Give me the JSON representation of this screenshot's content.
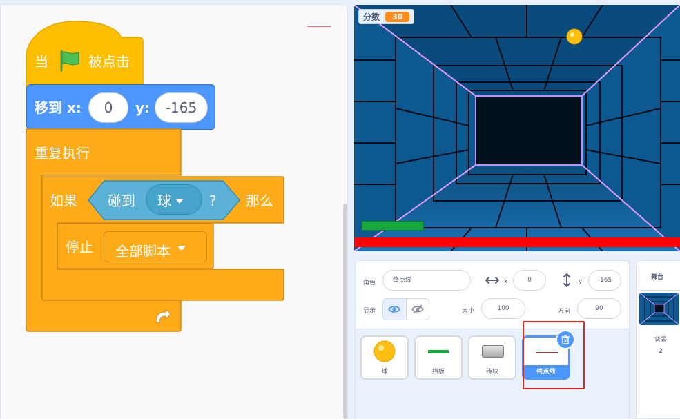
{
  "code": {
    "hat": {
      "prefix": "当",
      "suffix": "被点击"
    },
    "goto": {
      "label": "移到 x:",
      "x_value": "0",
      "y_label": "y:",
      "y_value": "-165"
    },
    "forever": {
      "label": "重复执行"
    },
    "if_block": {
      "if_label": "如果",
      "touching_label": "碰到",
      "touching_target": "球",
      "question": "?",
      "then_label": "那么"
    },
    "stop": {
      "label": "停止",
      "option": "全部脚本"
    }
  },
  "stage": {
    "monitor": {
      "label": "分数",
      "value": "30"
    }
  },
  "sprite_info": {
    "sprite_label": "角色",
    "sprite_name": "终点线",
    "x_label": "x",
    "x_value": "0",
    "y_label": "y",
    "y_value": "-165",
    "show_label": "显示",
    "size_label": "大小",
    "size_value": "100",
    "direction_label": "方向",
    "direction_value": "90"
  },
  "sprites": [
    {
      "name": "球"
    },
    {
      "name": "挡板"
    },
    {
      "name": "砖块"
    },
    {
      "name": "终点线"
    }
  ],
  "stage_panel": {
    "title": "舞台",
    "backdrop_label": "背景",
    "backdrop_count": "2"
  },
  "colors": {
    "event": "#ffbf00",
    "motion": "#4c97ff",
    "control": "#ffab19",
    "sensing": "#5cb1d6",
    "highlight": "#e52420"
  }
}
